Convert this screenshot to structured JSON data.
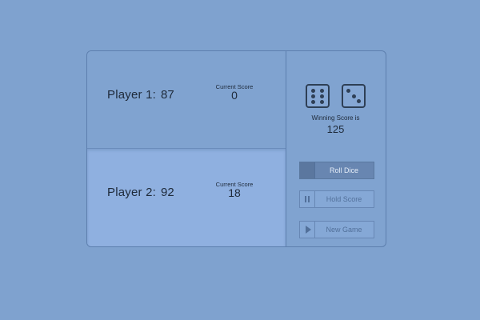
{
  "players": [
    {
      "label": "Player 1:",
      "total": "87",
      "current_label": "Current Score",
      "current_value": "0",
      "active": false
    },
    {
      "label": "Player 2:",
      "total": "92",
      "current_label": "Current Score",
      "current_value": "18",
      "active": true
    }
  ],
  "dice": [
    {
      "value": 6,
      "icon": "die-six-icon"
    },
    {
      "value": 3,
      "icon": "die-three-icon"
    }
  ],
  "winning": {
    "label": "Winning Score is",
    "value": "125"
  },
  "buttons": {
    "roll": {
      "label": "Roll Dice",
      "icon": "dice-icon"
    },
    "hold": {
      "label": "Hold Score",
      "icon": "pause-icon"
    },
    "new_game": {
      "label": "New Game",
      "icon": "play-icon"
    }
  },
  "colors": {
    "background": "#7fa2cf",
    "active_panel": "#8fb0e0",
    "text": "#1e2a3a",
    "primary_button": "#6886b1"
  }
}
